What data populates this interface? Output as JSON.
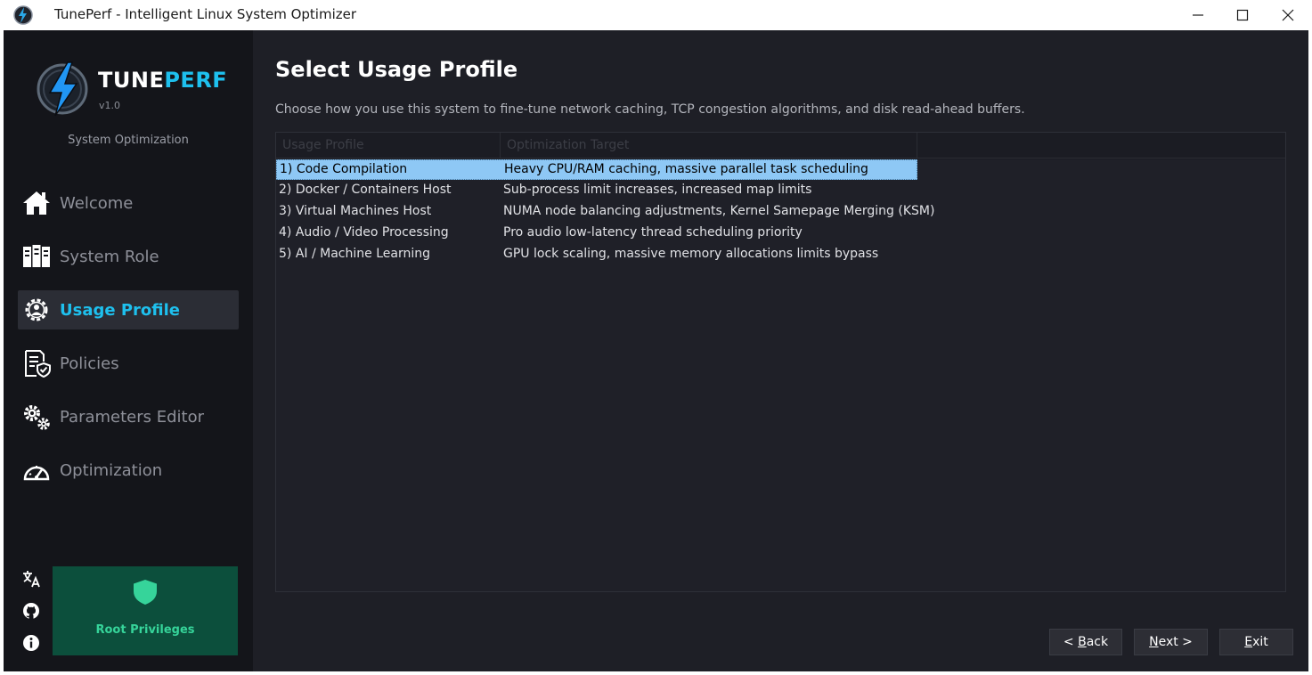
{
  "window": {
    "title": "TunePerf - Intelligent Linux System Optimizer",
    "controls": [
      "minimize-icon",
      "maximize-icon",
      "close-icon"
    ]
  },
  "brand": {
    "name_part1": "TUNE",
    "name_part2": "PERF",
    "version": "v1.0",
    "subtitle": "System Optimization",
    "accent_color": "#1ec0ee"
  },
  "sidebar": {
    "items": [
      {
        "label": "Welcome",
        "icon": "home-icon",
        "active": false
      },
      {
        "label": "System Role",
        "icon": "server-icon",
        "active": false
      },
      {
        "label": "Usage Profile",
        "icon": "user-gear-icon",
        "active": true
      },
      {
        "label": "Policies",
        "icon": "policy-icon",
        "active": false
      },
      {
        "label": "Parameters Editor",
        "icon": "gears-icon",
        "active": false
      },
      {
        "label": "Optimization",
        "icon": "gauge-icon",
        "active": false
      }
    ],
    "utility_icons": [
      "translate-icon",
      "github-icon",
      "info-icon"
    ],
    "root_status": {
      "label": "Root Privileges",
      "icon": "shield-icon",
      "color": "#36d49a"
    }
  },
  "main": {
    "title": "Select Usage Profile",
    "description": "Choose how you use this system to fine-tune network caching, TCP congestion algorithms, and disk read-ahead buffers.",
    "table": {
      "columns": [
        "Usage Profile",
        "Optimization Target"
      ],
      "rows": [
        {
          "profile": "1) Code Compilation",
          "target": "Heavy CPU/RAM caching, massive parallel task scheduling",
          "selected": true
        },
        {
          "profile": "2) Docker / Containers Host",
          "target": "Sub-process limit increases, increased map limits",
          "selected": false
        },
        {
          "profile": "3) Virtual Machines Host",
          "target": "NUMA node balancing adjustments, Kernel Samepage Merging (KSM)",
          "selected": false
        },
        {
          "profile": "4) Audio / Video Processing",
          "target": "Pro audio low-latency thread scheduling priority",
          "selected": false
        },
        {
          "profile": "5) AI / Machine Learning",
          "target": "GPU lock scaling, massive memory allocations limits bypass",
          "selected": false
        }
      ]
    }
  },
  "buttons": {
    "back_prefix": "< ",
    "back_mnemonic": "B",
    "back_rest": "ack",
    "next_mnemonic": "N",
    "next_rest": "ext >",
    "exit_mnemonic": "E",
    "exit_rest": "xit"
  }
}
